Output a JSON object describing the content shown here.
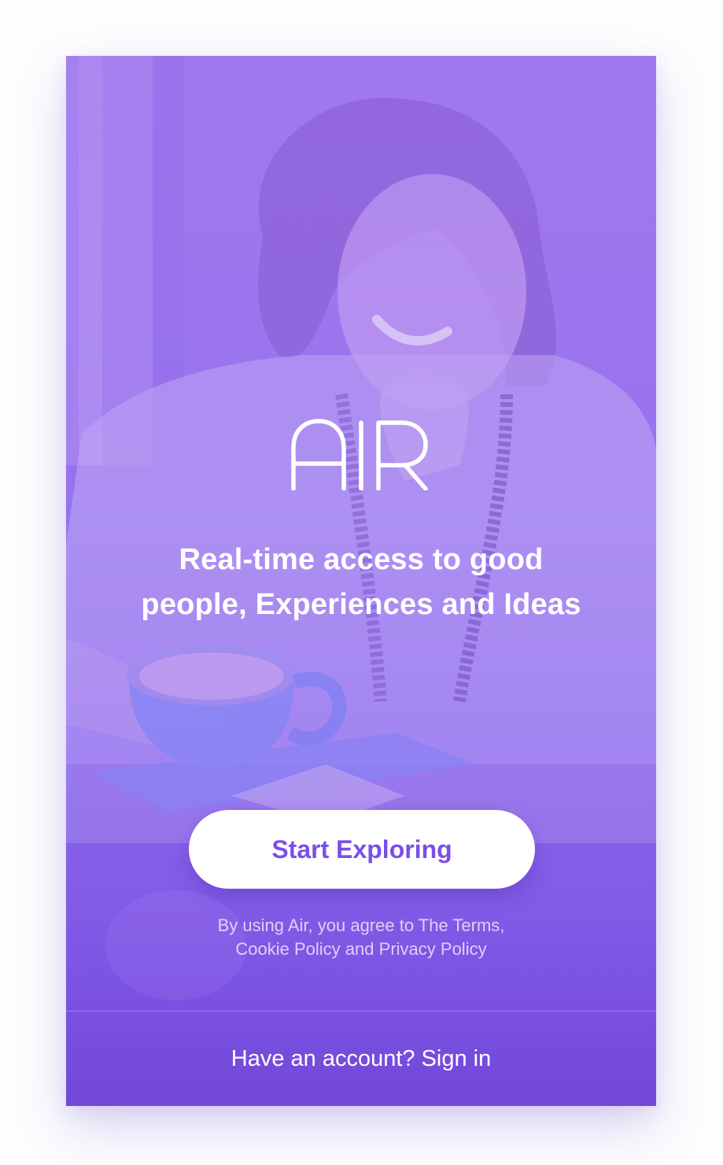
{
  "app": {
    "logo_text": "AIR",
    "tagline_line1": "Real-time access to good",
    "tagline_line2": "people, Experiences and Ideas"
  },
  "cta": {
    "label": "Start Exploring"
  },
  "legal": {
    "prefix": "By using Air, you agree to",
    "terms_link": "The Terms,",
    "cookie_link": "Cookie Policy",
    "and_text": "and",
    "privacy_link": "Privacy Policy"
  },
  "footer": {
    "prompt": "Have an account?",
    "signin_label": "Sign in"
  },
  "colors": {
    "accent": "#7a4fe6",
    "background_top": "#a57ff0",
    "background_bottom": "#6f46d8"
  },
  "background": {
    "subject": "smiling woman at cafe table with coffee cup"
  }
}
